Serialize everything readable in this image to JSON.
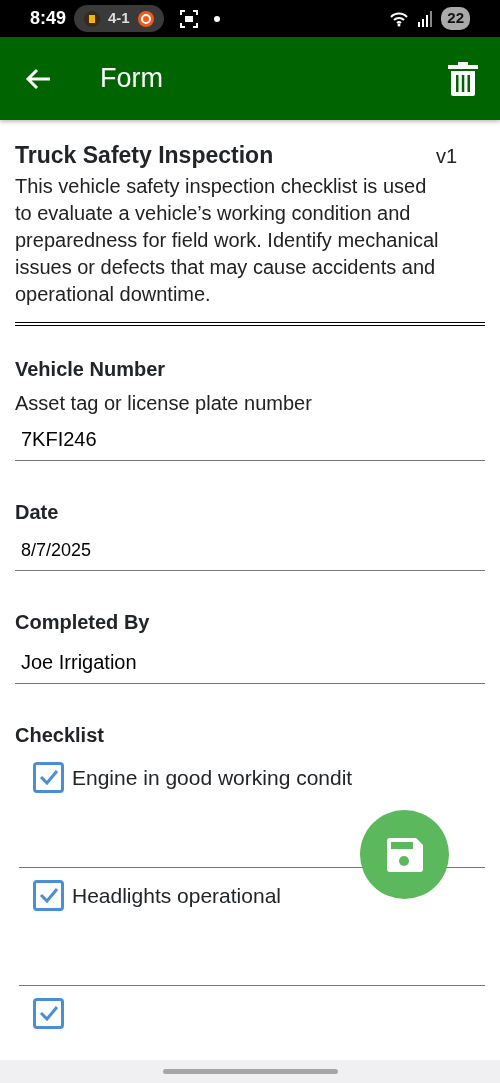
{
  "status_bar": {
    "time": "8:49",
    "score": "4-1",
    "battery": "22"
  },
  "app_bar": {
    "title": "Form"
  },
  "form": {
    "title": "Truck Safety Inspection",
    "version": "v1",
    "description": "This vehicle safety inspection checklist is used to evaluate a vehicle’s working condition and preparedness for field work. Identify mechanical issues or defects that may cause accidents and operational downtime.",
    "fields": [
      {
        "kind": "text",
        "label": "Vehicle Number",
        "hint": "Asset tag or license plate number",
        "value": "7KFI246"
      },
      {
        "kind": "date",
        "label": "Date",
        "value": "8/7/2025"
      },
      {
        "kind": "text",
        "label": "Completed By",
        "value": "Joe Irrigation"
      }
    ],
    "checklist": {
      "label": "Checklist",
      "items": [
        {
          "label": "Engine in good working condit",
          "checked": true
        },
        {
          "label": "Headlights operational",
          "checked": true
        },
        {
          "checked": true
        }
      ]
    }
  }
}
